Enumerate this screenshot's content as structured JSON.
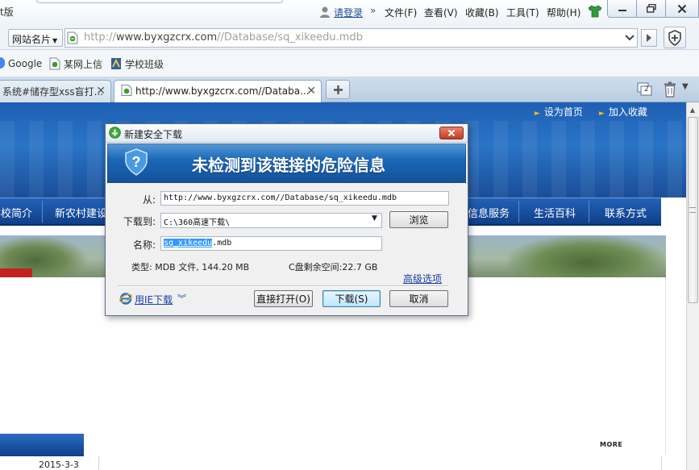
{
  "titlebar": {
    "edition_fragment": "t版",
    "login_label": "请登录",
    "menu_chevron": "»",
    "menu": [
      "文件(F)",
      "查看(V)",
      "收藏(B)",
      "工具(T)",
      "帮助(H)"
    ]
  },
  "addressbar": {
    "site_card_label": "网站名片",
    "url_prefix": "http://",
    "url_host": "www.byxgzcrx.com",
    "url_path": "//Database/sq_xikeedu.mdb"
  },
  "favorites": [
    {
      "label": "Google",
      "icon": "google-icon"
    },
    {
      "label": "某网上信",
      "icon": "page-icon"
    },
    {
      "label": "学校班级",
      "icon": "bookmark-icon"
    }
  ],
  "tabs": [
    {
      "label": "系统#储存型xss盲打...",
      "active": false
    },
    {
      "label": "http://www.byxgzcrx.com//Databa...",
      "active": true
    }
  ],
  "tabs_count": "2",
  "webpage": {
    "top_links": [
      "设为首页",
      "加入收藏"
    ],
    "nav": [
      "学校简介",
      "新农村建设",
      "信息服务",
      "生活百科",
      "联系方式"
    ],
    "more_label": "MORE",
    "date": "2015-3-3"
  },
  "dialog": {
    "title": "新建安全下载",
    "heading": "未检测到该链接的危险信息",
    "from_label": "从:",
    "from_value": "http://www.byxgzcrx.com//Database/sq_xikeedu.mdb",
    "dest_label": "下载到:",
    "dest_value": "C:\\360高速下载\\",
    "browse_label": "浏览",
    "name_label": "名称:",
    "name_selected": "sq_xikeedu",
    "name_ext": ".mdb",
    "type_info": "类型: MDB 文件, 144.20 MB",
    "space_info": "C盘剩余空间:22.7 GB",
    "advanced_label": "高级选项",
    "ie_download_label": "用IE下载",
    "open_label": "直接打开(O)",
    "download_label": "下载(S)",
    "cancel_label": "取消"
  },
  "colors": {
    "accent_blue": "#1a64b2",
    "link_blue": "#1a3fa6",
    "close_red": "#c33a22",
    "selection": "#3399ff"
  }
}
